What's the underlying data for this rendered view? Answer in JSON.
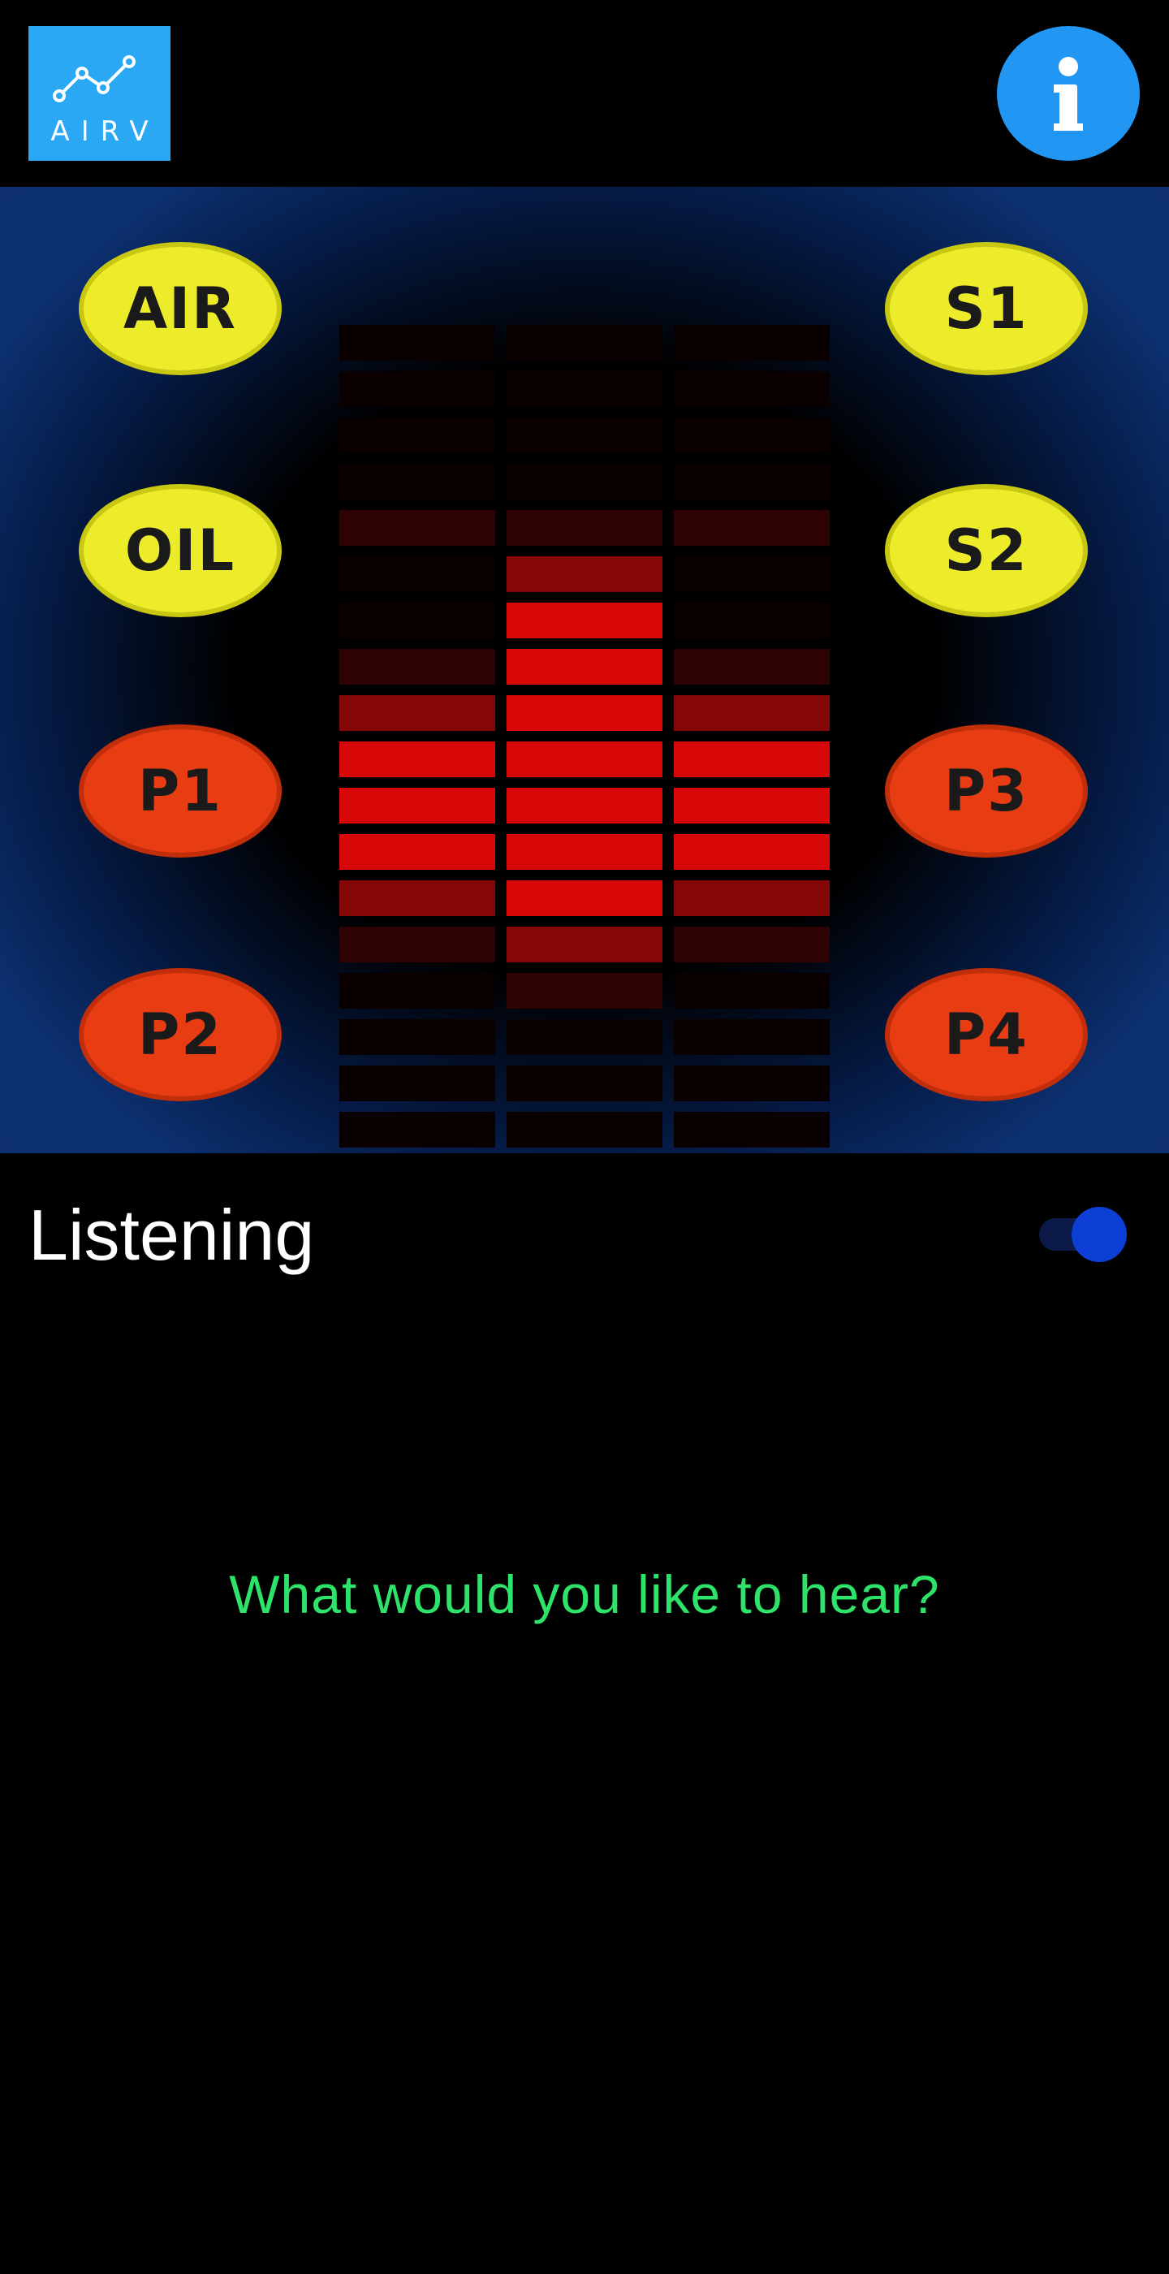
{
  "header": {
    "logo_text": "AIRV",
    "logo_icon": "line-chart-icon",
    "info_icon": "info-icon"
  },
  "dashboard": {
    "left_buttons": [
      {
        "label": "AIR",
        "color": "yellow"
      },
      {
        "label": "OIL",
        "color": "yellow"
      },
      {
        "label": "P1",
        "color": "red"
      },
      {
        "label": "P2",
        "color": "red"
      }
    ],
    "right_buttons": [
      {
        "label": "S1",
        "color": "yellow"
      },
      {
        "label": "S2",
        "color": "yellow"
      },
      {
        "label": "P3",
        "color": "red"
      },
      {
        "label": "P4",
        "color": "red"
      }
    ],
    "colors": {
      "yellow": "#ecec2a",
      "red": "#e83c12",
      "bar_bright": "#d80808",
      "bar_mid": "#840606",
      "bar_dim": "#2e0202",
      "bar_off": "#0a0000"
    }
  },
  "listening": {
    "label": "Listening",
    "toggle_on": true
  },
  "prompt": {
    "text": "What would you like to hear?",
    "color": "#2ee36a"
  }
}
